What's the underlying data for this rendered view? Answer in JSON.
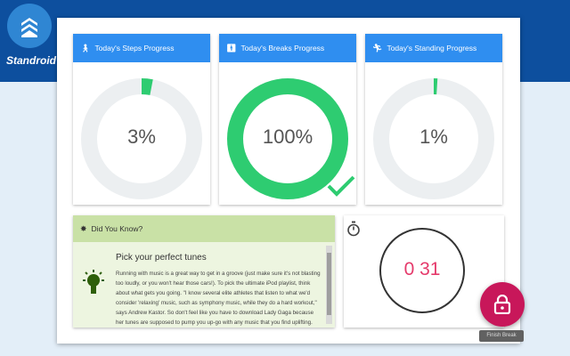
{
  "app": {
    "name": "Standroid"
  },
  "cards": [
    {
      "title": "Today's Steps Progress",
      "percent_text": "3%",
      "progress": 0.03,
      "icon": "walking-person-icon"
    },
    {
      "title": "Today's Breaks Progress",
      "percent_text": "100%",
      "progress": 1.0,
      "icon": "person-icon"
    },
    {
      "title": "Today's Standing Progress",
      "percent_text": "1%",
      "progress": 0.01,
      "icon": "standing-icon"
    }
  ],
  "did_you_know": {
    "header": "Did You Know?",
    "tip_title": "Pick your perfect tunes",
    "tip_text": "Running with music is a great way to get in a groove (just make sure it's not blasting too loudly, or you won't hear those cars!). To pick the ultimate iPod playlist, think about what gets you going. \"I know several elite athletes that listen to what we'd consider 'relaxing' music, such as symphony music, while they do a hard workout,\" says Andrew Kastor. So don't feel like you have to download Lady Gaga because her tunes are supposed to pump you up-go with any music that you find uplifting."
  },
  "timer": {
    "value": "0 31"
  },
  "fab": {
    "tooltip": "Finish Break",
    "icon": "lock-icon"
  },
  "colors": {
    "header_blue": "#2f8ef0",
    "progress_green": "#2ecc71",
    "ring_gray": "#eceff1",
    "timer_pink": "#e53a6b",
    "fab_red": "#c8175a",
    "tip_green": "#c9e1a6"
  }
}
